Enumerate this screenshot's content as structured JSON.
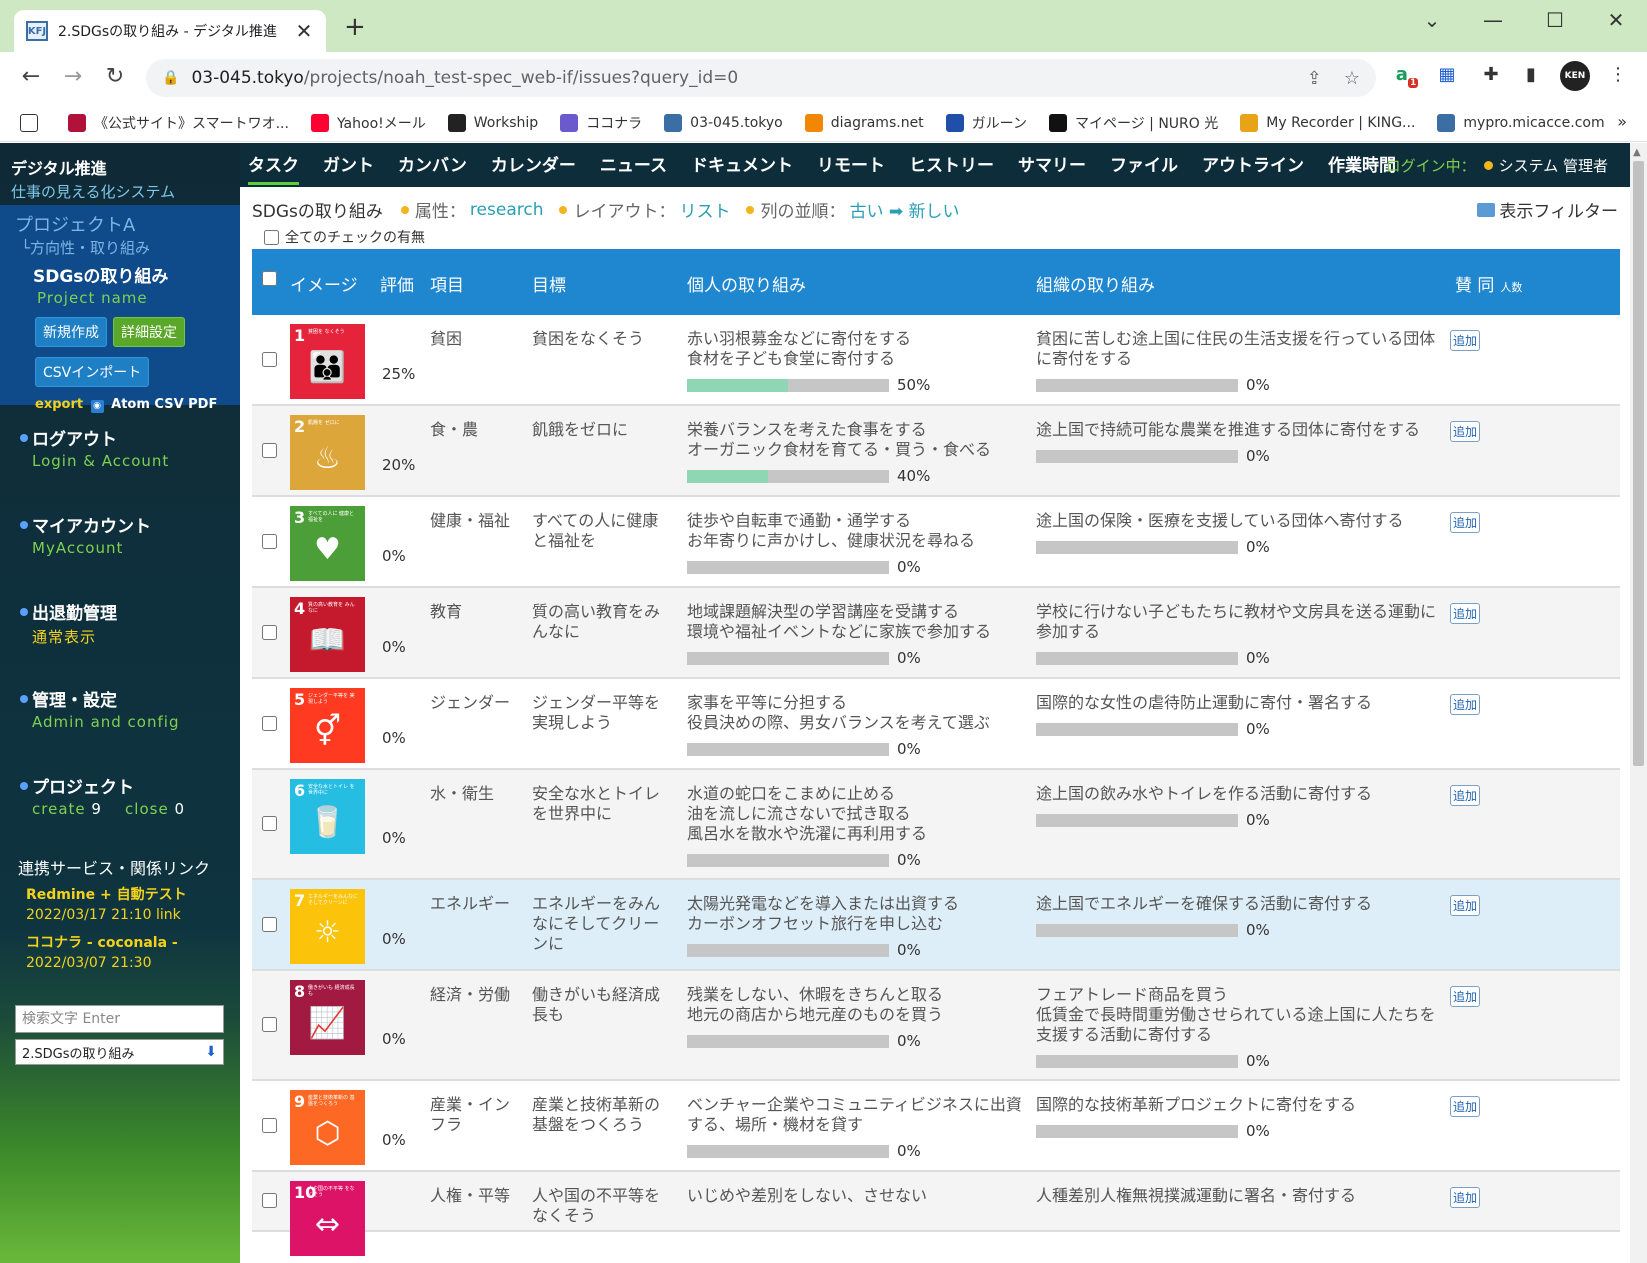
{
  "browser": {
    "tab_title": "2.SDGsの取り組み - デジタル推進",
    "favicon_text": "KFJ",
    "url_host": "03-045.tokyo",
    "url_path": "/projects/noah_test-spec_web-if/issues?query_id=0",
    "avatar_text": "KEN",
    "ext_badge": "1",
    "bookmarks": [
      {
        "label": "",
        "color": "#ffffff"
      },
      {
        "label": "《公式サイト》スマートワオ...",
        "color": "#b0123a"
      },
      {
        "label": "Yahoo!メール",
        "color": "#ff0033"
      },
      {
        "label": "Workship",
        "color": "#222222"
      },
      {
        "label": "ココナラ",
        "color": "#6a5acd"
      },
      {
        "label": "03-045.tokyo",
        "color": "#3a6ea5"
      },
      {
        "label": "diagrams.net",
        "color": "#f08705"
      },
      {
        "label": "ガルーン",
        "color": "#1f4fa8"
      },
      {
        "label": "マイページ | NURO 光",
        "color": "#111111"
      },
      {
        "label": "My Recorder | KING...",
        "color": "#e8a317"
      },
      {
        "label": "mypro.micacce.com",
        "color": "#3a6ea5"
      }
    ]
  },
  "sidebar": {
    "brand_title": "デジタル推進",
    "brand_sub": "仕事の見える化システム",
    "project_name": "プロジェクトA",
    "project_sub": "└方向性・取り組み",
    "project_current": "SDGsの取り組み",
    "project_label": "Project name",
    "btn_new": "新規作成",
    "btn_detail": "詳細設定",
    "btn_csv": "CSVインポート",
    "export_label": "export",
    "export_links": "Atom CSV PDF",
    "menu": [
      {
        "title": "ログアウト",
        "sub": "Login & Account"
      },
      {
        "title": "マイアカウント",
        "sub": "MyAccount"
      },
      {
        "title": "出退勤管理",
        "sub": "通常表示"
      },
      {
        "title": "管理・設定",
        "sub": "Admin and config"
      }
    ],
    "project_menu": {
      "title": "プロジェクト",
      "create_label": "create",
      "create_count": "9",
      "close_label": "close",
      "close_count": "0"
    },
    "links_title": "連携サービス・関係リンク",
    "links": [
      {
        "name": "Redmine + 自動テスト",
        "date": "2022/03/17 21:10 link"
      },
      {
        "name": "ココナラ - coconala -",
        "date": "2022/03/07 21:30"
      }
    ],
    "search_placeholder": "検索文字 Enter",
    "select_value": "2.SDGsの取り組み"
  },
  "appnav": {
    "items": [
      "タスク",
      "ガント",
      "カンバン",
      "カレンダー",
      "ニュース",
      "ドキュメント",
      "リモート",
      "ヒストリー",
      "サマリー",
      "ファイル",
      "アウトライン",
      "作業時間"
    ],
    "login_label": "ログイン中：",
    "login_user": "システム 管理者"
  },
  "filter": {
    "title": "SDGsの取り組み",
    "attr_label": "属性：",
    "attr_value": "research",
    "layout_label": "レイアウト：",
    "layout_value": "リスト",
    "order_label": "列の並順：",
    "order_value": "古い ➡ 新しい",
    "display_filter": "表示フィルター",
    "check_all": "全てのチェックの有無"
  },
  "table": {
    "headers": {
      "image": "イメージ",
      "rate": "評価",
      "item": "項目",
      "goal": "目標",
      "individual": "個人の取り組み",
      "org": "組織の取り組み",
      "support": "賛 同",
      "support_unit": "人数"
    },
    "add_label": "追加",
    "rows": [
      {
        "num": "1",
        "icon_label": "貧困を なくそう",
        "icon_glyph": "👪",
        "color": "#e5243b",
        "rate": "25%",
        "item": "貧困",
        "goal": "貧困をなくそう",
        "individual": "赤い羽根募金などに寄付をする\n食材を子ども食堂に寄付する",
        "ind_pct": "50%",
        "ind_progress": 50,
        "org": "貧困に苦しむ途上国に住民の生活支援を行っている団体に寄付をする",
        "org_pct": "0%",
        "org_progress": 0
      },
      {
        "num": "2",
        "icon_label": "飢餓を ゼロに",
        "icon_glyph": "♨",
        "color": "#dda63a",
        "rate": "20%",
        "item": "食・農",
        "goal": "飢餓をゼロに",
        "individual": "栄養バランスを考えた食事をする\nオーガニック食材を育てる・買う・食べる",
        "ind_pct": "40%",
        "ind_progress": 40,
        "org": "途上国で持続可能な農業を推進する団体に寄付をする",
        "org_pct": "0%",
        "org_progress": 0
      },
      {
        "num": "3",
        "icon_label": "すべての人に 健康と福祉を",
        "icon_glyph": "♥",
        "color": "#4c9f38",
        "rate": "0%",
        "item": "健康・福祉",
        "goal": "すべての人に健康と福祉を",
        "individual": "徒歩や自転車で通勤・通学する\nお年寄りに声かけし、健康状況を尋ねる",
        "ind_pct": "0%",
        "ind_progress": 0,
        "org": "途上国の保険・医療を支援している団体へ寄付する",
        "org_pct": "0%",
        "org_progress": 0
      },
      {
        "num": "4",
        "icon_label": "質の高い教育を みんなに",
        "icon_glyph": "📖",
        "color": "#c5192d",
        "rate": "0%",
        "item": "教育",
        "goal": "質の高い教育をみんなに",
        "individual": "地域課題解決型の学習講座を受講する\n環境や福祉イベントなどに家族で参加する",
        "ind_pct": "0%",
        "ind_progress": 0,
        "org": "学校に行けない子どもたちに教材や文房具を送る運動に参加する",
        "org_pct": "0%",
        "org_progress": 0
      },
      {
        "num": "5",
        "icon_label": "ジェンダー平等を 実現しよう",
        "icon_glyph": "⚥",
        "color": "#ff3a21",
        "rate": "0%",
        "item": "ジェンダー",
        "goal": "ジェンダー平等を実現しよう",
        "individual": "家事を平等に分担する\n役員決めの際、男女バランスを考えて選ぶ",
        "ind_pct": "0%",
        "ind_progress": 0,
        "org": "国際的な女性の虐待防止運動に寄付・署名する",
        "org_pct": "0%",
        "org_progress": 0
      },
      {
        "num": "6",
        "icon_label": "安全な水とトイレ を世界中に",
        "icon_glyph": "🥛",
        "color": "#26bde2",
        "rate": "0%",
        "item": "水・衛生",
        "goal": "安全な水とトイレを世界中に",
        "individual": "水道の蛇口をこまめに止める\n油を流しに流さないで拭き取る\n風呂水を散水や洗濯に再利用する",
        "ind_pct": "0%",
        "ind_progress": 0,
        "org": "途上国の飲み水やトイレを作る活動に寄付する",
        "org_pct": "0%",
        "org_progress": 0
      },
      {
        "num": "7",
        "icon_label": "エネルギーをみんなに そしてクリーンに",
        "icon_glyph": "☼",
        "color": "#fcc30b",
        "rate": "0%",
        "item": "エネルギー",
        "goal": "エネルギーをみんなにそしてクリーンに",
        "individual": "太陽光発電などを導入または出資する\nカーボンオフセット旅行を申し込む",
        "ind_pct": "0%",
        "ind_progress": 0,
        "org": "途上国でエネルギーを確保する活動に寄付する",
        "org_pct": "0%",
        "org_progress": 0
      },
      {
        "num": "8",
        "icon_label": "働きがいも 経済成長も",
        "icon_glyph": "📈",
        "color": "#a21942",
        "rate": "0%",
        "item": "経済・労働",
        "goal": "働きがいも経済成長も",
        "individual": "残業をしない、休暇をきちんと取る\n地元の商店から地元産のものを買う",
        "ind_pct": "0%",
        "ind_progress": 0,
        "org": "フェアトレード商品を買う\n低賃金で長時間重労働させられている途上国に人たちを支援する活動に寄付する",
        "org_pct": "0%",
        "org_progress": 0
      },
      {
        "num": "9",
        "icon_label": "産業と技術革新の 基盤をつくろう",
        "icon_glyph": "⬡",
        "color": "#fd6925",
        "rate": "0%",
        "item": "産業・インフラ",
        "goal": "産業と技術革新の基盤をつくろう",
        "individual": "ベンチャー企業やコミュニティビジネスに出資する、場所・機材を貸す",
        "ind_pct": "0%",
        "ind_progress": 0,
        "org": "国際的な技術革新プロジェクトに寄付をする",
        "org_pct": "0%",
        "org_progress": 0
      },
      {
        "num": "10",
        "icon_label": "人や国の不平等 をなくそう",
        "icon_glyph": "⇔",
        "color": "#dd1367",
        "rate": "",
        "item": "人権・平等",
        "goal": "人や国の不平等をなくそう",
        "individual": "いじめや差別をしない、させない",
        "ind_pct": "",
        "ind_progress": 0,
        "org": "人種差別人権無視撲滅運動に署名・寄付する",
        "org_pct": "",
        "org_progress": 0
      }
    ]
  }
}
